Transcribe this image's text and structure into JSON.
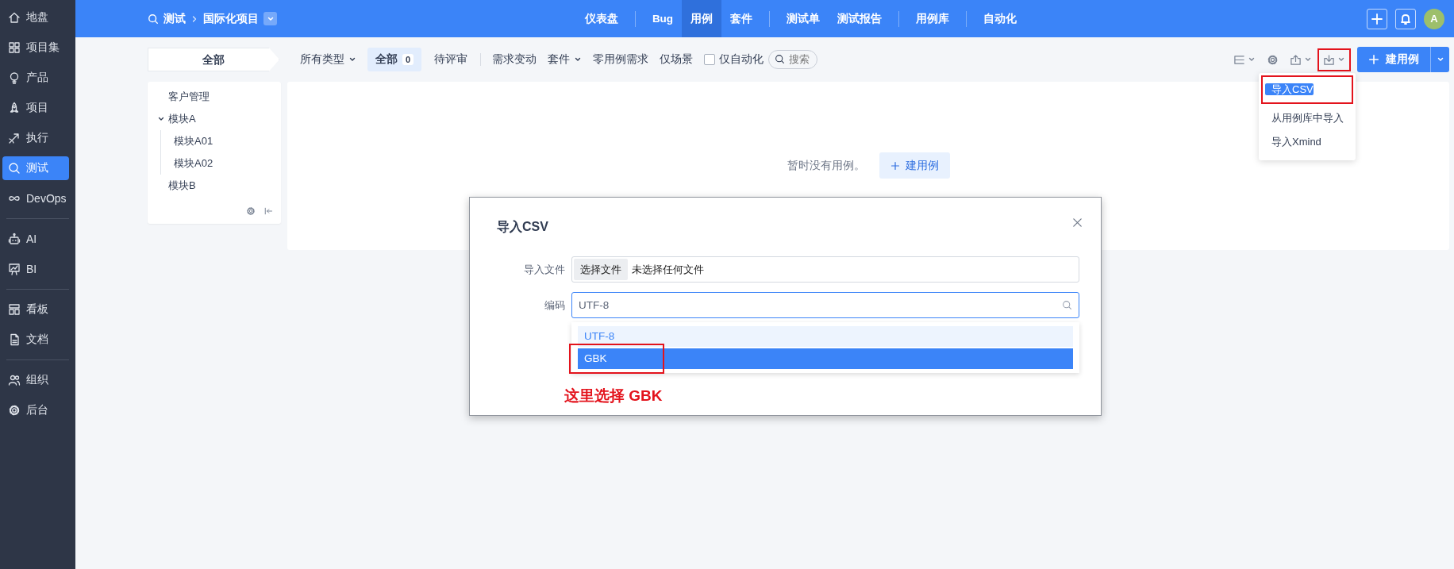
{
  "sidebar": {
    "groups": [
      [
        {
          "label": "地盘",
          "selected": false
        },
        {
          "label": "项目集",
          "selected": false
        },
        {
          "label": "产品",
          "selected": false
        },
        {
          "label": "项目",
          "selected": false
        },
        {
          "label": "执行",
          "selected": false
        },
        {
          "label": "测试",
          "selected": true
        },
        {
          "label": "DevOps",
          "selected": false
        }
      ],
      [
        {
          "label": "AI",
          "selected": false
        },
        {
          "label": "BI",
          "selected": false
        }
      ],
      [
        {
          "label": "看板",
          "selected": false
        },
        {
          "label": "文档",
          "selected": false
        }
      ],
      [
        {
          "label": "组织",
          "selected": false
        },
        {
          "label": "后台",
          "selected": false
        }
      ]
    ]
  },
  "header": {
    "breadcrumb": [
      "测试",
      "国际化项目"
    ],
    "nav_groups": [
      [
        {
          "label": "仪表盘",
          "selected": false
        }
      ],
      [
        {
          "label": "Bug",
          "selected": false
        },
        {
          "label": "用例",
          "selected": true
        },
        {
          "label": "套件",
          "selected": false
        }
      ],
      [
        {
          "label": "测试单",
          "selected": false
        },
        {
          "label": "测试报告",
          "selected": false
        }
      ],
      [
        {
          "label": "用例库",
          "selected": false
        }
      ],
      [
        {
          "label": "自动化",
          "selected": false
        }
      ]
    ],
    "avatar": "A"
  },
  "toolbar": {
    "scope": "全部",
    "type_filter": "所有类型",
    "tabs": [
      {
        "label": "全部",
        "count": "0",
        "selected": true
      },
      {
        "label": "待评审",
        "selected": false
      }
    ],
    "filters": [
      {
        "kind": "link",
        "label": "需求变动"
      },
      {
        "kind": "dropdown",
        "label": "套件"
      },
      {
        "kind": "link",
        "label": "零用例需求"
      },
      {
        "kind": "link",
        "label": "仅场景"
      },
      {
        "kind": "checkbox",
        "label": "仅自动化",
        "checked": false
      }
    ],
    "search": {
      "placeholder": "搜索"
    },
    "import_marked": true,
    "create_button": "建用例"
  },
  "import_menu": [
    {
      "label": "导入CSV",
      "selected": true,
      "marked": true
    },
    {
      "label": "从用例库中导入",
      "selected": false,
      "marked": false
    },
    {
      "label": "导入Xmind",
      "selected": false,
      "marked": false
    }
  ],
  "tree": {
    "items": [
      {
        "label": "客户管理"
      },
      {
        "label": "模块A",
        "expanded": true,
        "children": [
          {
            "label": "模块A01"
          },
          {
            "label": "模块A02"
          }
        ]
      },
      {
        "label": "模块B"
      }
    ]
  },
  "empty_state": {
    "message": "暂时没有用例。",
    "button": "建用例"
  },
  "dialog": {
    "title": "导入CSV",
    "file_label": "导入文件",
    "file_button": "选择文件",
    "file_status": "未选择任何文件",
    "encoding_label": "编码",
    "encoding_value": "UTF-8",
    "options": [
      {
        "label": "UTF-8",
        "selected": true,
        "highlighted": false,
        "marked": false
      },
      {
        "label": "GBK",
        "selected": false,
        "highlighted": true,
        "marked": true
      }
    ],
    "annotation": "这里选择 GBK"
  }
}
